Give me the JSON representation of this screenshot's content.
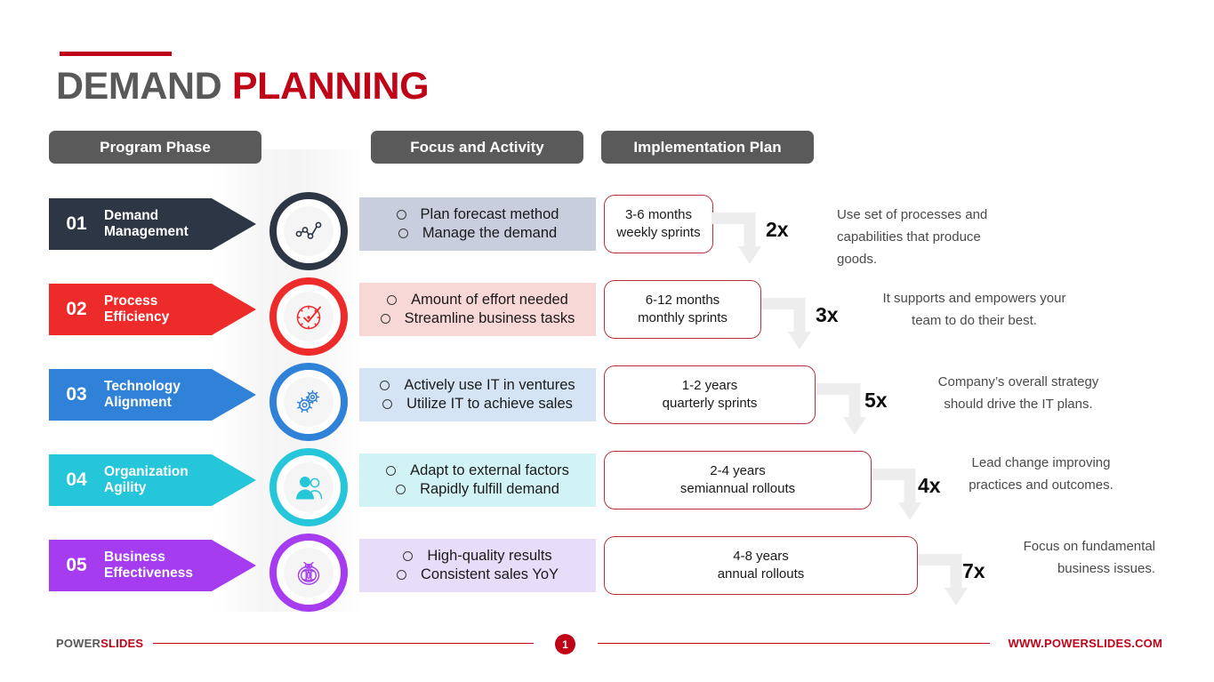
{
  "title": {
    "part1": "DEMAND ",
    "part2": "PLANNING"
  },
  "columns": {
    "phase": "Program Phase",
    "focus": "Focus and Activity",
    "implementation": "Implementation Plan"
  },
  "colors": {
    "accent_red": "#c00418",
    "header_grey": "#5a5a5a",
    "title_grey": "#595959",
    "arrow_grey": "#ededed",
    "box_border_red": "#b8323a"
  },
  "rows": [
    {
      "number": "01",
      "phase_label_1": "Demand",
      "phase_label_2": "Management",
      "color": "#2d3644",
      "icon": "line-chart-icon",
      "focus_bg": "#c8cedd",
      "focus": [
        "Plan forecast method",
        "Manage the demand"
      ],
      "impl_line_1": "3-6 months",
      "impl_line_2": "weekly sprints",
      "multiplier": "2x",
      "note": "Use set of processes and capabilities that produce goods."
    },
    {
      "number": "02",
      "phase_label_1": "Process",
      "phase_label_2": "Efficiency",
      "color": "#ee2b2b",
      "icon": "speedometer-check-icon",
      "focus_bg": "#f8d7d7",
      "focus": [
        "Amount of effort needed",
        "Streamline business tasks"
      ],
      "impl_line_1": "6-12 months",
      "impl_line_2": "monthly sprints",
      "multiplier": "3x",
      "note": "It supports and empowers your team to do their best."
    },
    {
      "number": "03",
      "phase_label_1": "Technology",
      "phase_label_2": "Alignment",
      "color": "#3082d8",
      "icon": "gears-icon",
      "focus_bg": "#d4e4f5",
      "focus": [
        "Actively use IT in ventures",
        "Utilize IT to achieve sales"
      ],
      "impl_line_1": "1-2 years",
      "impl_line_2": "quarterly sprints",
      "multiplier": "5x",
      "note": "Company’s overall strategy should drive the IT plans."
    },
    {
      "number": "04",
      "phase_label_1": "Organization",
      "phase_label_2": "Agility",
      "color": "#26c6da",
      "icon": "people-icon",
      "focus_bg": "#d2f3f6",
      "focus": [
        "Adapt to external factors",
        "Rapidly fulfill demand"
      ],
      "impl_line_1": "2-4 years",
      "impl_line_2": "semiannual rollouts",
      "multiplier": "4x",
      "note": "Lead change improving practices and outcomes."
    },
    {
      "number": "05",
      "phase_label_1": "Business",
      "phase_label_2": "Effectiveness",
      "color": "#a63cf0",
      "icon": "stopwatch-badge-icon",
      "focus_bg": "#e7ddf8",
      "focus": [
        "High-quality results",
        "Consistent sales YoY"
      ],
      "impl_line_1": "4-8 years",
      "impl_line_2": "annual rollouts",
      "multiplier": "7x",
      "note": "Focus on fundamental business issues."
    }
  ],
  "footer": {
    "logo_part1": "POWER",
    "logo_part2": "SLIDES",
    "page_number": "1",
    "url": "WWW.POWERSLIDES.COM"
  }
}
